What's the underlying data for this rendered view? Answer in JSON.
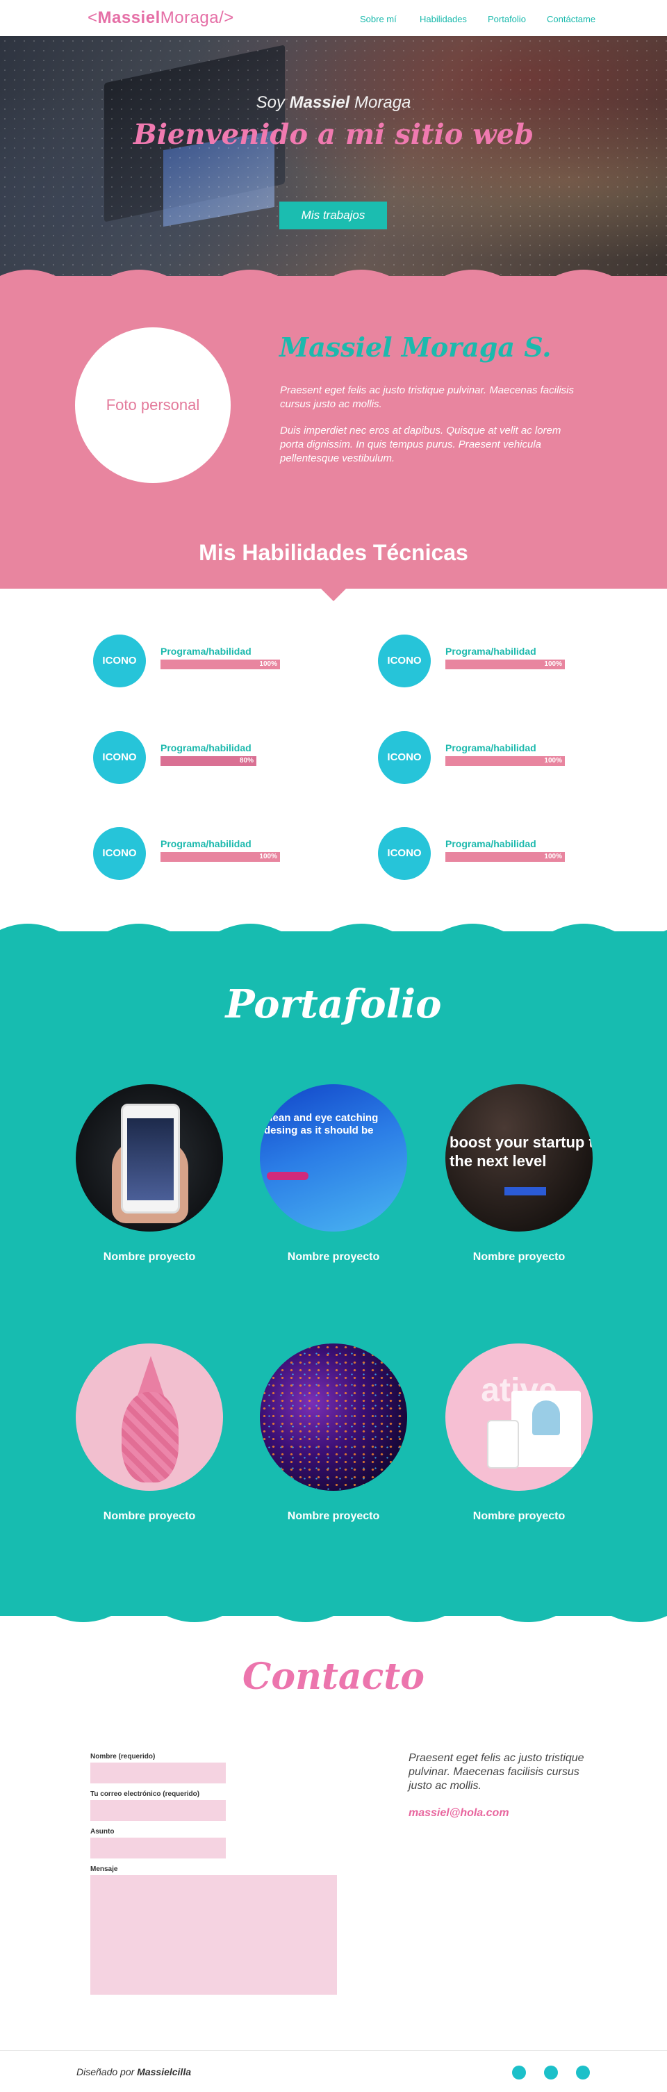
{
  "nav": {
    "logo_bold": "Massiel",
    "logo_light": "Moraga",
    "logo_open": "<",
    "logo_close": "/>",
    "items": [
      "Sobre mí",
      "Habilidades",
      "Portafolio",
      "Contáctame"
    ]
  },
  "hero": {
    "intro_prefix": "Soy ",
    "intro_bold": "Massiel",
    "intro_suffix": " Moraga",
    "welcome": "Bienvenido a mi sitio web",
    "button": "Mis trabajos"
  },
  "about": {
    "photo_placeholder": "Foto personal",
    "name": "Massiel Moraga S.",
    "paragraph1": "Praesent eget felis ac justo tristique pulvinar. Maecenas facilisis cursus justo ac mollis.",
    "paragraph2": "Duis imperdiet nec eros at dapibus. Quisque at velit ac lorem porta dignissim. In quis tempus purus. Praesent vehicula pellentesque vestibulum."
  },
  "skills": {
    "title": "Mis Habilidades Técnicas",
    "items": [
      {
        "icon": "ICONO",
        "label": "Programa/habilidad",
        "percent_text": "100%",
        "level": 100
      },
      {
        "icon": "ICONO",
        "label": "Programa/habilidad",
        "percent_text": "100%",
        "level": 100
      },
      {
        "icon": "ICONO",
        "label": "Programa/habilidad",
        "percent_text": "80%",
        "level": 80
      },
      {
        "icon": "ICONO",
        "label": "Programa/habilidad",
        "percent_text": "100%",
        "level": 100
      },
      {
        "icon": "ICONO",
        "label": "Programa/habilidad",
        "percent_text": "100%",
        "level": 100
      },
      {
        "icon": "ICONO",
        "label": "Programa/habilidad",
        "percent_text": "100%",
        "level": 100
      }
    ]
  },
  "portfolio": {
    "title": "Portafolio",
    "projects": [
      {
        "name": "Nombre proyecto"
      },
      {
        "name": "Nombre proyecto",
        "image_text": "clean and eye catching desing as it should be"
      },
      {
        "name": "Nombre proyecto",
        "image_text": "boost your startup to the next level"
      },
      {
        "name": "Nombre proyecto"
      },
      {
        "name": "Nombre proyecto"
      },
      {
        "name": "Nombre proyecto",
        "image_text": "ative"
      }
    ]
  },
  "contact": {
    "title": "Contacto",
    "labels": {
      "name": "Nombre (requerido)",
      "email": "Tu correo electrónico (requerido)",
      "subject": "Asunto",
      "message": "Mensaje"
    },
    "paragraph": "Praesent eget felis ac justo tristique pulvinar. Maecenas facilisis cursus justo ac mollis.",
    "email": "massiel@hola.com"
  },
  "footer": {
    "credit_prefix": "Diseñado por ",
    "credit_name": "Massielcilla"
  },
  "colors": {
    "pink": "#e8859f",
    "teal": "#17bcb0",
    "cyan": "#26c4d9",
    "accent_pink": "#ec75ad"
  }
}
